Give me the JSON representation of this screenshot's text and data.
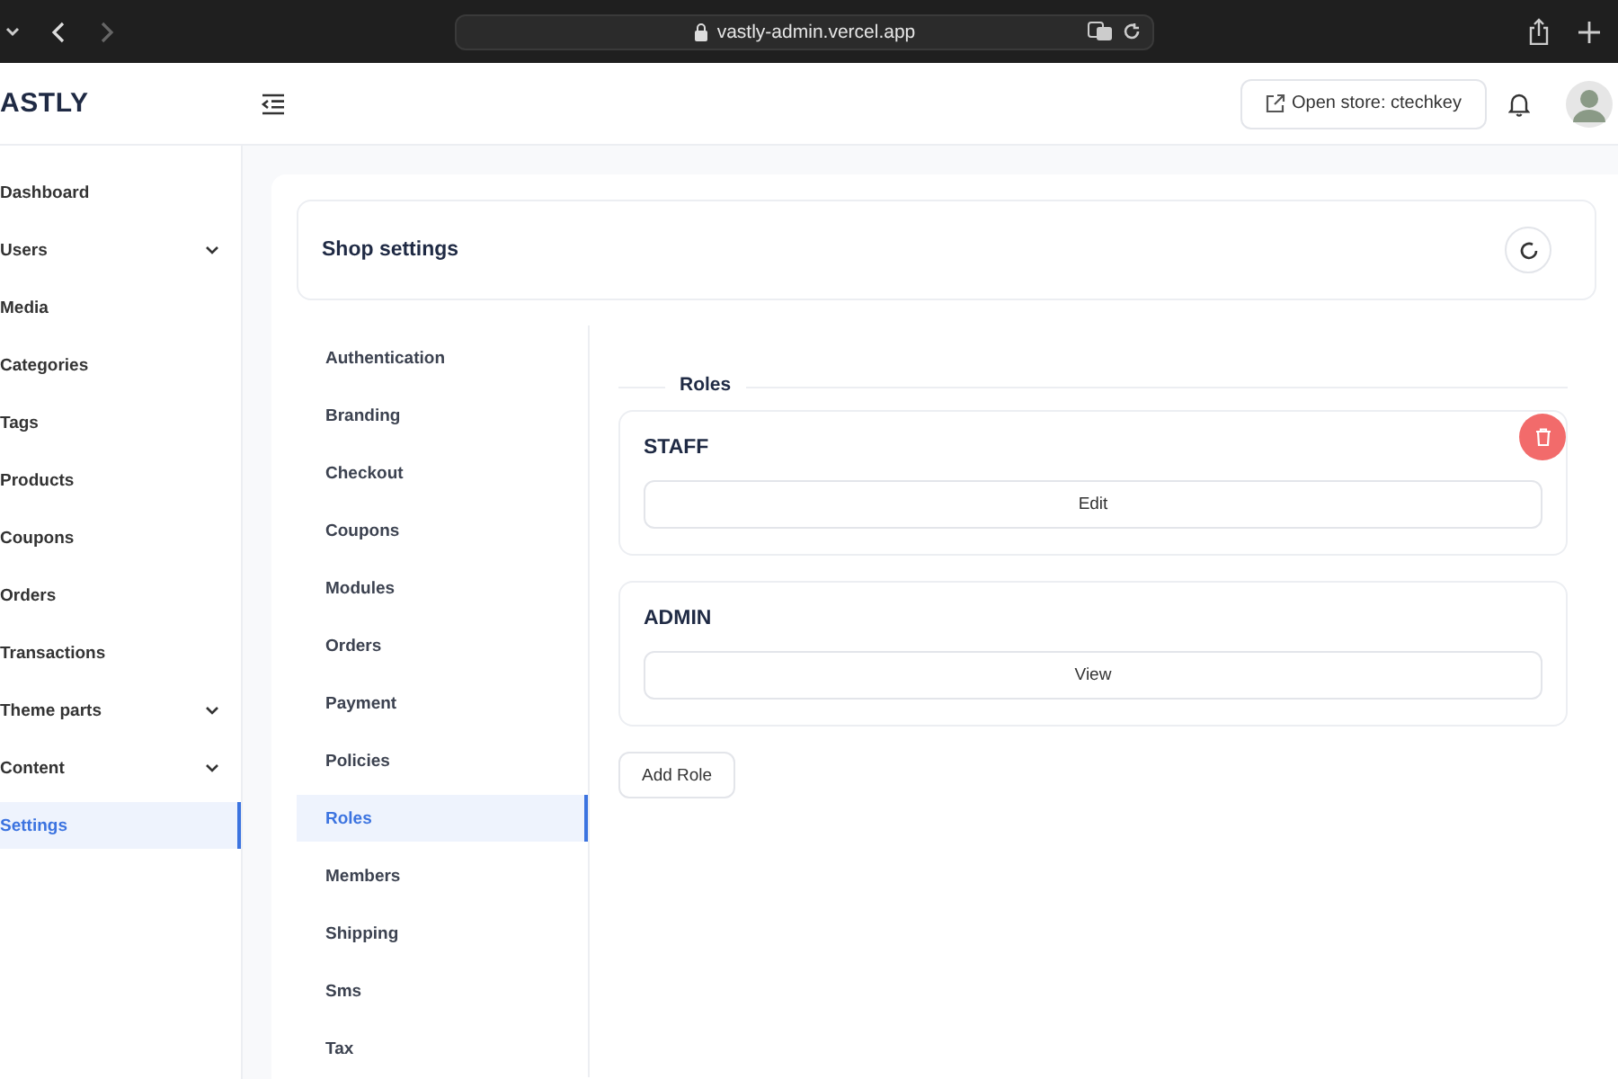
{
  "browser": {
    "address": "vastly-admin.vercel.app"
  },
  "header": {
    "logo": "ASTLY",
    "store_button": "Open store: ctechkey"
  },
  "sidebar": {
    "items": [
      {
        "label": "Dashboard",
        "kind": "link",
        "selected": false
      },
      {
        "label": "Users",
        "kind": "group",
        "selected": false
      },
      {
        "label": "Media",
        "kind": "link",
        "selected": false
      },
      {
        "label": "Categories",
        "kind": "link",
        "selected": false
      },
      {
        "label": "Tags",
        "kind": "link",
        "selected": false
      },
      {
        "label": "Products",
        "kind": "link",
        "selected": false
      },
      {
        "label": "Coupons",
        "kind": "link",
        "selected": false
      },
      {
        "label": "Orders",
        "kind": "link",
        "selected": false
      },
      {
        "label": "Transactions",
        "kind": "link",
        "selected": false
      },
      {
        "label": "Theme parts",
        "kind": "group",
        "selected": false
      },
      {
        "label": "Content",
        "kind": "group",
        "selected": false
      },
      {
        "label": "Settings",
        "kind": "link",
        "selected": true
      }
    ]
  },
  "page": {
    "title": "Shop settings"
  },
  "settings_nav": {
    "items": [
      {
        "label": "Authentication",
        "selected": false
      },
      {
        "label": "Branding",
        "selected": false
      },
      {
        "label": "Checkout",
        "selected": false
      },
      {
        "label": "Coupons",
        "selected": false
      },
      {
        "label": "Modules",
        "selected": false
      },
      {
        "label": "Orders",
        "selected": false
      },
      {
        "label": "Payment",
        "selected": false
      },
      {
        "label": "Policies",
        "selected": false
      },
      {
        "label": "Roles",
        "selected": true
      },
      {
        "label": "Members",
        "selected": false
      },
      {
        "label": "Shipping",
        "selected": false
      },
      {
        "label": "Sms",
        "selected": false
      },
      {
        "label": "Tax",
        "selected": false
      }
    ]
  },
  "roles": {
    "heading": "Roles",
    "items": [
      {
        "name": "STAFF",
        "button": "Edit",
        "deletable": true
      },
      {
        "name": "ADMIN",
        "button": "View",
        "deletable": false
      }
    ],
    "add_button": "Add Role"
  }
}
